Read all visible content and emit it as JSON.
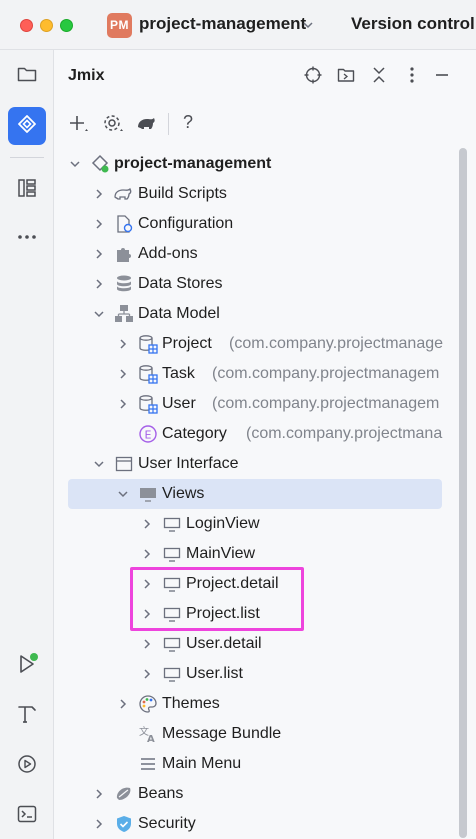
{
  "titlebar": {
    "project_badge": "PM",
    "project_name": "project-management",
    "vcs_label": "Version control"
  },
  "panel": {
    "title": "Jmix",
    "help_label": "?"
  },
  "tree": {
    "root": "project-management",
    "items": {
      "build_scripts": "Build Scripts",
      "configuration": "Configuration",
      "add_ons": "Add-ons",
      "data_stores": "Data Stores",
      "data_model": "Data Model",
      "project": "Project",
      "project_pkg": "(com.company.projectmanage",
      "task": "Task",
      "task_pkg": "(com.company.projectmanagem",
      "user": "User",
      "user_pkg": "(com.company.projectmanagem",
      "category": "Category",
      "category_pkg": "(com.company.projectmana",
      "user_interface": "User Interface",
      "views": "Views",
      "login_view": "LoginView",
      "main_view": "MainView",
      "project_detail": "Project.detail",
      "project_list": "Project.list",
      "user_detail": "User.detail",
      "user_list": "User.list",
      "themes": "Themes",
      "message_bundle": "Message Bundle",
      "main_menu": "Main Menu",
      "beans": "Beans",
      "security": "Security"
    }
  },
  "colors": {
    "accent": "#3574f0",
    "selection": "#dbe4f6",
    "highlight": "#ee44dd",
    "badge": "#e07a5f",
    "run_dot": "#3fb950"
  }
}
